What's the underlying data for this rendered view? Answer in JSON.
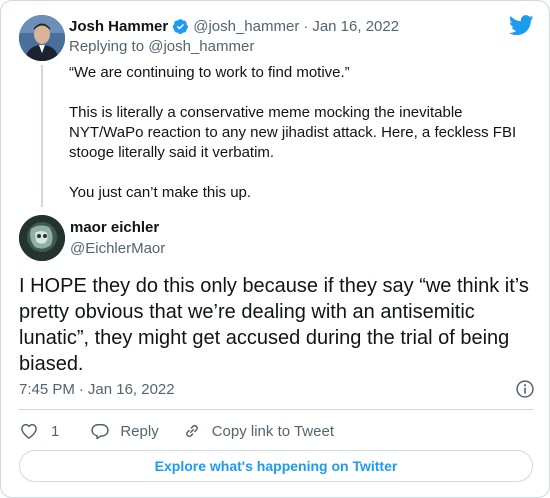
{
  "colors": {
    "brand_blue": "#1d9bf0",
    "text_primary": "#0f1419",
    "text_secondary": "#536471",
    "border": "#cfd9de"
  },
  "parent_tweet": {
    "author_name": "Josh Hammer",
    "verified_icon": "verified-badge-icon",
    "handle": "@josh_hammer",
    "separator": "·",
    "date": "Jan 16, 2022",
    "replying_to": "Replying to @josh_hammer",
    "paragraphs": [
      "“We are continuing to work to find motive.”",
      "This is literally a conservative meme mocking the inevitable NYT/WaPo reaction to any new jihadist attack. Here, a feckless FBI stooge literally said it verbatim.",
      "You just can’t make this up."
    ]
  },
  "main_tweet": {
    "author_name": "maor eichler",
    "handle": "@EichlerMaor",
    "text": "I HOPE they do this only because if they say “we think it’s pretty obvious that we’re dealing with an antisemitic lunatic”, they might get accused during the trial of being biased.",
    "time": "7:45 PM",
    "separator": "·",
    "date": "Jan 16, 2022"
  },
  "actions": {
    "like_count": "1",
    "reply_label": "Reply",
    "copy_link_label": "Copy link to Tweet"
  },
  "footer": {
    "explore_label": "Explore what's happening on Twitter"
  },
  "icons": {
    "logo": "twitter-bird-icon",
    "info": "info-icon",
    "like": "heart-icon",
    "reply": "reply-bubble-icon",
    "link": "link-icon"
  }
}
